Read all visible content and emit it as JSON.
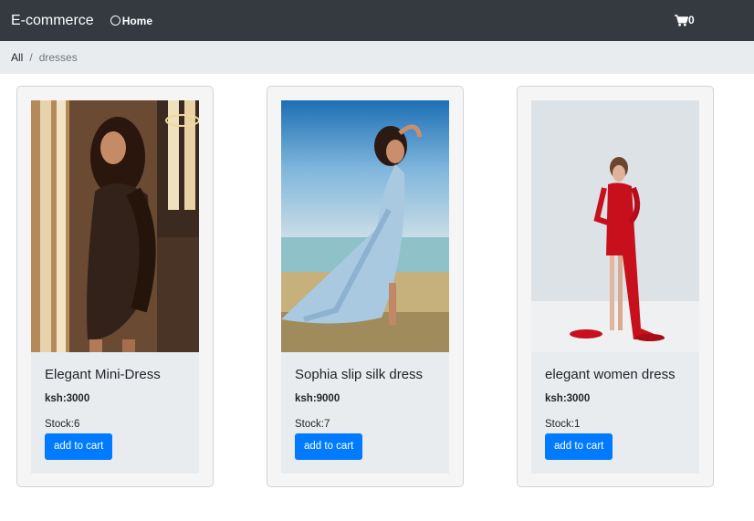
{
  "navbar": {
    "brand": "E-commerce",
    "home_label": "Home",
    "cart_count": "0"
  },
  "breadcrumb": {
    "root": "All",
    "current": "dresses"
  },
  "products": [
    {
      "name": "Elegant Mini-Dress",
      "price": "ksh:3000",
      "stock": "Stock:6",
      "button": "add to cart"
    },
    {
      "name": "Sophia slip silk dress",
      "price": "ksh:9000",
      "stock": "Stock:7",
      "button": "add to cart"
    },
    {
      "name": "elegant women dress",
      "price": "ksh:3000",
      "stock": "Stock:1",
      "button": "add to cart"
    }
  ],
  "colors": {
    "navbar": "#343a40",
    "breadcrumb_bg": "#e9ecef",
    "primary_button": "#007bff"
  }
}
